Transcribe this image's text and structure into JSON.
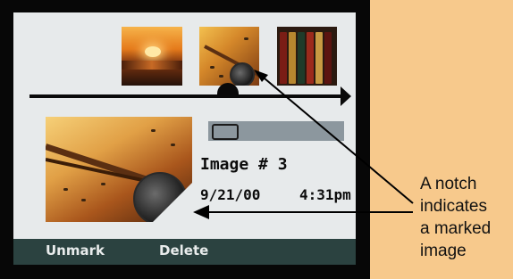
{
  "screen": {
    "image_label": "Image # 3",
    "date": "9/21/00",
    "time": "4:31pm"
  },
  "softkeys": {
    "unmark_label": "Unmark",
    "delete_label": "Delete"
  },
  "callout": {
    "line1": "A notch",
    "line2": "indicates",
    "line3": "a marked",
    "line4": "image"
  },
  "colors": {
    "page_background": "#f7c98c",
    "softkey_bar": "#2b4240",
    "screen_background": "#e7eaeb",
    "frame": "#070707"
  }
}
